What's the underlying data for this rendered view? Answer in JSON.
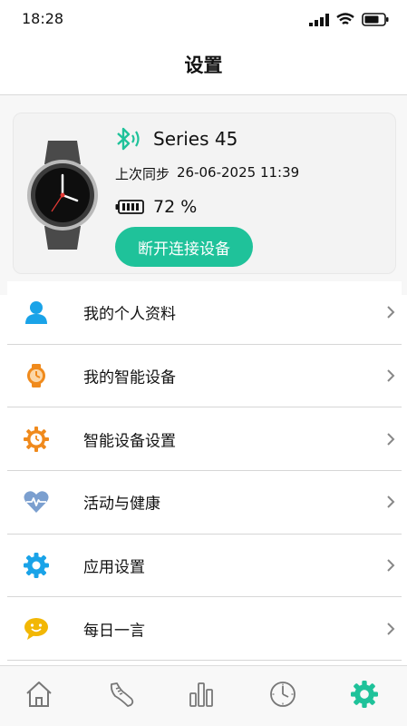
{
  "status_bar": {
    "time": "18:28"
  },
  "nav": {
    "title": "设置"
  },
  "device": {
    "name": "Series 45",
    "last_sync_label": "上次同步",
    "last_sync_value": "26-06-2025 11:39",
    "battery_percent": "72 %",
    "disconnect_label": "断开连接设备"
  },
  "menu": {
    "items": [
      {
        "label": "我的个人资料",
        "icon": "person-icon"
      },
      {
        "label": "我的智能设备",
        "icon": "watch-icon"
      },
      {
        "label": "智能设备设置",
        "icon": "gear-clock-icon"
      },
      {
        "label": "活动与健康",
        "icon": "heart-pulse-icon"
      },
      {
        "label": "应用设置",
        "icon": "gear-icon"
      },
      {
        "label": "每日一言",
        "icon": "smile-chat-icon"
      }
    ]
  },
  "tab_bar": {
    "tabs": [
      "home-icon",
      "shoe-icon",
      "bar-chart-icon",
      "clock-icon",
      "settings-icon"
    ],
    "active": "settings-icon"
  },
  "colors": {
    "accent": "#1fc29a",
    "blue": "#1aa3e8",
    "orange": "#f08a1c",
    "heart": "#7b9fcf",
    "smile": "#f2b705"
  }
}
